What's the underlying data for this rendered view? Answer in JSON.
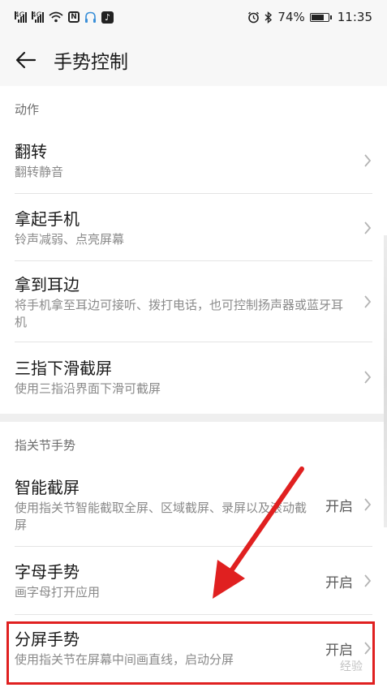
{
  "status_bar": {
    "signal1_tag": "4G",
    "signal2_tag": "4G",
    "nfc_label": "N",
    "tiktok_label": "♪",
    "battery_percent": "74%",
    "battery_level": 0.74,
    "time": "11:35",
    "icons": [
      "signal-icon",
      "signal-icon",
      "wifi-icon",
      "nfc-icon",
      "headset-icon",
      "tiktok-icon",
      "alarm-icon",
      "bluetooth-icon",
      "battery-icon"
    ]
  },
  "header": {
    "title": "手势控制",
    "back_icon": "arrow-left-icon"
  },
  "sections": [
    {
      "header": "动作",
      "rows": [
        {
          "title": "翻转",
          "subtitle": "翻转静音",
          "value": ""
        },
        {
          "title": "拿起手机",
          "subtitle": "铃声减弱、点亮屏幕",
          "value": ""
        },
        {
          "title": "拿到耳边",
          "subtitle": "将手机拿至耳边可接听、拨打电话，也可控制扬声器或蓝牙耳机",
          "value": ""
        },
        {
          "title": "三指下滑截屏",
          "subtitle": "使用三指沿界面下滑可截屏",
          "value": ""
        }
      ]
    },
    {
      "header": "指关节手势",
      "rows": [
        {
          "title": "智能截屏",
          "subtitle": "使用指关节智能截取全屏、区域截屏、录屏以及滚动截屏",
          "value": "开启"
        },
        {
          "title": "字母手势",
          "subtitle": "画字母打开应用",
          "value": "开启"
        },
        {
          "title": "分屏手势",
          "subtitle": "使用指关节在屏幕中间画直线，启动分屏",
          "value": "开启"
        }
      ]
    }
  ],
  "watermark": "经验",
  "colors": {
    "highlight": "#e02020",
    "background": "#f7f7f7",
    "card": "#ffffff"
  }
}
